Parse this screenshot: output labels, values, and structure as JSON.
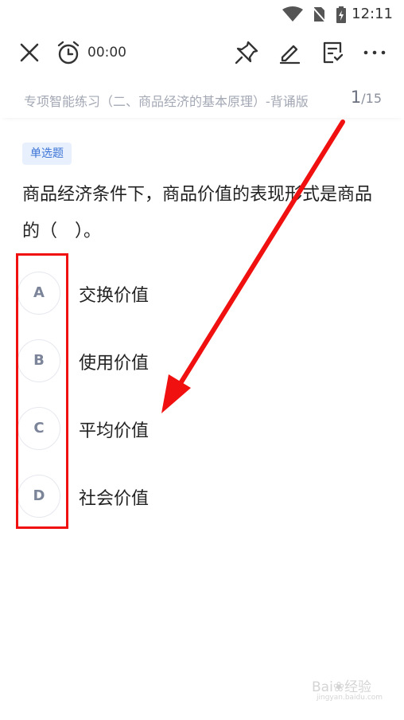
{
  "status_bar": {
    "time": "12:11"
  },
  "toolbar": {
    "timer": "00:00"
  },
  "header": {
    "subtitle": "专项智能练习（二、商品经济的基本原理）-背诵版",
    "current_page": "1",
    "total_pages": "/15"
  },
  "question": {
    "type_tag": "单选题",
    "text": "商品经济条件下，商品价值的表现形式是商品的（　）。",
    "options": [
      {
        "letter": "A",
        "text": "交换价值"
      },
      {
        "letter": "B",
        "text": "使用价值"
      },
      {
        "letter": "C",
        "text": "平均价值"
      },
      {
        "letter": "D",
        "text": "社会价值"
      }
    ]
  },
  "watermark": {
    "brand": "Bai",
    "brand_suffix": "经验",
    "url": "jingyan.baidu.com"
  },
  "colors": {
    "annotation_red": "#f01010",
    "tag_blue": "#3b74d6",
    "tag_bg": "#e8f0fd"
  }
}
